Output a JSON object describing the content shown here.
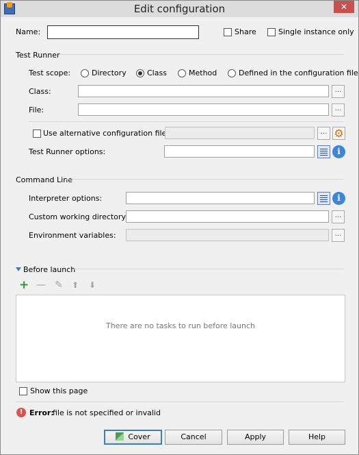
{
  "window": {
    "title": "Edit configuration",
    "close_glyph": "✕"
  },
  "top": {
    "name_label": "Name:",
    "name_value": "",
    "share_label": "Share",
    "single_instance_label": "Single instance only"
  },
  "test_runner": {
    "section_title": "Test Runner",
    "scope_label": "Test scope:",
    "scope_options": [
      "Directory",
      "Class",
      "Method",
      "Defined in the configuration file"
    ],
    "scope_selected": "Class",
    "class_label": "Class:",
    "class_value": "",
    "file_label": "File:",
    "file_value": "",
    "alt_config_label": "Use alternative configuration file:",
    "alt_config_value": "",
    "options_label": "Test Runner options:",
    "options_value": ""
  },
  "command_line": {
    "section_title": "Command Line",
    "interpreter_label": "Interpreter options:",
    "interpreter_value": "",
    "working_dir_label": "Custom working directory:",
    "working_dir_value": "",
    "env_label": "Environment variables:",
    "env_value": ""
  },
  "before_launch": {
    "section_title": "Before launch",
    "empty_text": "There are no tasks to run before launch",
    "tools": [
      "add-icon",
      "remove-icon",
      "edit-icon",
      "move-up-icon",
      "move-down-icon"
    ]
  },
  "show_page_label": "Show this page",
  "error": {
    "prefix": "Error:",
    "message": "file is not specified or invalid"
  },
  "buttons": {
    "cover": "Cover",
    "cancel": "Cancel",
    "apply": "Apply",
    "help": "Help"
  },
  "glyphs": {
    "ellipsis": "...",
    "info": "i",
    "gear": "⚙",
    "add": "+",
    "remove": "—",
    "edit": "✎",
    "up": "⬆",
    "down": "⬇",
    "error": "!"
  },
  "colors": {
    "accent": "#3c7fb1",
    "error": "#d9534f",
    "add": "#2e9a2e"
  }
}
